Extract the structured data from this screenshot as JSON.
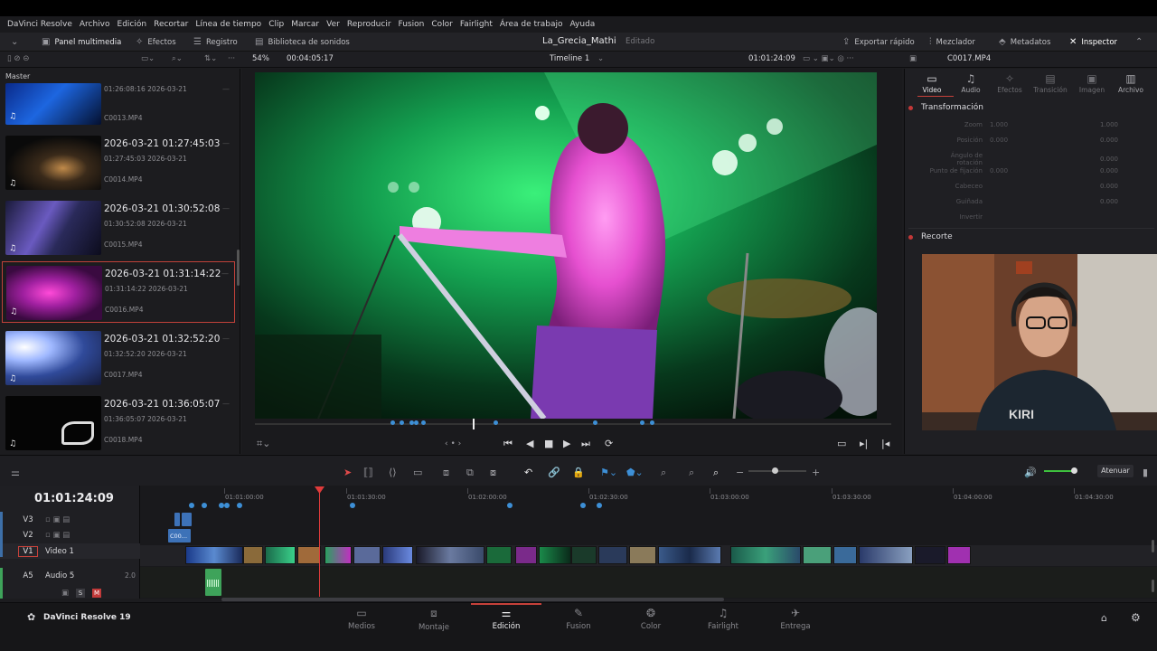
{
  "menu": [
    "DaVinci Resolve",
    "Archivo",
    "Edición",
    "Recortar",
    "Línea de tiempo",
    "Clip",
    "Marcar",
    "Ver",
    "Reproducir",
    "Fusion",
    "Color",
    "Fairlight",
    "Área de trabajo",
    "Ayuda"
  ],
  "toolbar": {
    "media_pool": "Panel multimedia",
    "effects": "Efectos",
    "index": "Registro",
    "sound_library": "Biblioteca de sonidos",
    "project_name": "La_Grecia_Mathi",
    "project_status": "Editado",
    "quick_export": "Exportar rápido",
    "mixer": "Mezclador",
    "metadata": "Metadatos",
    "inspector": "Inspector"
  },
  "viewer_bar": {
    "zoom": "54%",
    "source_tc": "00:04:05:17",
    "timeline_name": "Timeline 1",
    "record_tc": "01:01:24:09",
    "clip_name": "C0017.MP4"
  },
  "media_pool": {
    "bin": "Master",
    "clips": [
      {
        "title": "",
        "time": "01:26:08:16",
        "date": "2026-03-21",
        "name": "C0013.MP4"
      },
      {
        "title": "2026-03-21  01:27:45:03",
        "time": "01:27:45:03",
        "date": "2026-03-21",
        "name": "C0014.MP4"
      },
      {
        "title": "2026-03-21  01:30:52:08",
        "time": "01:30:52:08",
        "date": "2026-03-21",
        "name": "C0015.MP4"
      },
      {
        "title": "2026-03-21  01:31:14:22",
        "time": "01:31:14:22",
        "date": "2026-03-21",
        "name": "C0016.MP4"
      },
      {
        "title": "2026-03-21  01:32:52:20",
        "time": "01:32:52:20",
        "date": "2026-03-21",
        "name": "C0017.MP4"
      },
      {
        "title": "2026-03-21  01:36:05:07",
        "time": "01:36:05:07",
        "date": "2026-03-21",
        "name": "C0018.MP4"
      }
    ]
  },
  "inspector": {
    "tabs": [
      "Video",
      "Audio",
      "Efectos",
      "Transición",
      "Imagen",
      "Archivo"
    ],
    "section_transform": "Transformación",
    "section_crop": "Recorte",
    "rows": [
      {
        "label": "Zoom",
        "a": "1.000",
        "b": "1.000"
      },
      {
        "label": "Posición",
        "a": "0.000",
        "b": "0.000"
      },
      {
        "label": "Ángulo de rotación",
        "a": "",
        "b": "0.000"
      },
      {
        "label": "Punto de fijación",
        "a": "0.000",
        "b": "0.000"
      },
      {
        "label": "Cabeceo",
        "a": "",
        "b": "0.000"
      },
      {
        "label": "Guiñada",
        "a": "",
        "b": "0.000"
      },
      {
        "label": "Invertir",
        "a": "",
        "b": ""
      }
    ]
  },
  "timeline": {
    "timecode": "01:01:24:09",
    "ruler": [
      "01:01:00:00",
      "01:01:30:00",
      "01:02:00:00",
      "01:02:30:00",
      "01:03:00:00",
      "01:03:30:00",
      "01:04:00:00",
      "01:04:30:00"
    ],
    "tracks": [
      {
        "id": "V3",
        "name": ""
      },
      {
        "id": "V2",
        "name": ""
      },
      {
        "id": "V1",
        "name": "Video 1"
      },
      {
        "id": "A5",
        "name": "Audio 5",
        "level": "2.0"
      }
    ],
    "v2_clip_label": "C00...",
    "mute_label": "M",
    "solo_label": "S",
    "dim_button": "Atenuar"
  },
  "pages": [
    "Medios",
    "Montaje",
    "Edición",
    "Fusion",
    "Color",
    "Fairlight",
    "Entrega"
  ],
  "app_brand": "DaVinci Resolve 19",
  "colors": {
    "accent": "#c6413a",
    "marker": "#3d8fd6"
  }
}
